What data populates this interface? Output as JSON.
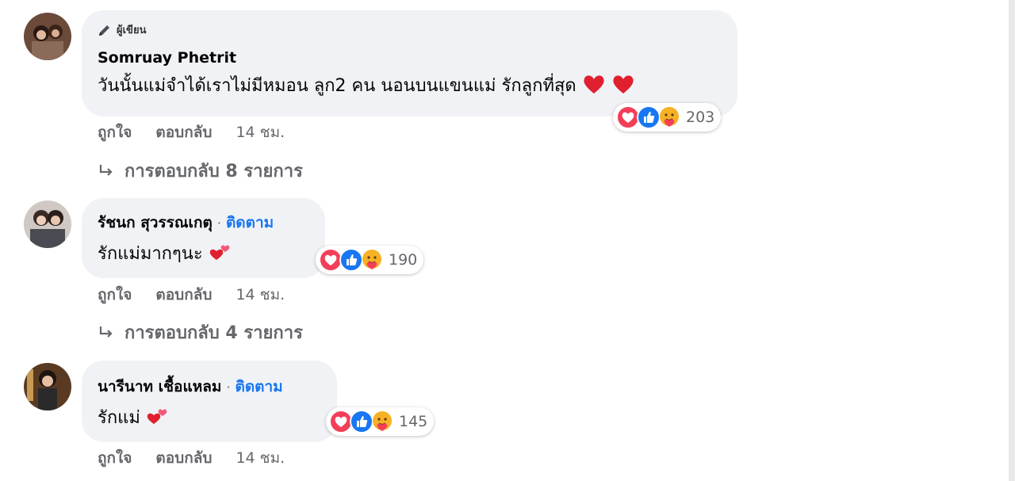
{
  "comments": [
    {
      "author_badge": "ผู้เขียน",
      "author": "Somruay Phetrit",
      "follow_label": "",
      "text": "วันนั้นแม่จำได้เราไม่มีหมอน ลูก2 คน นอนบนแขนแม่ รักลูกที่สุด",
      "trailing_emoji": "❤️❤️",
      "reaction_icons": [
        "love-icon",
        "like-icon",
        "care-icon"
      ],
      "reaction_count": "203",
      "actions": {
        "like": "ถูกใจ",
        "reply": "ตอบกลับ",
        "time": "14 ชม."
      },
      "replies_label": "การตอบกลับ 8 รายการ"
    },
    {
      "author_badge": "",
      "author": "รัชนก สุวรรณเกตุ",
      "separator": "·",
      "follow_label": "ติดตาม",
      "text": "รักแม่มากๆนะ",
      "trailing_emoji": "💕",
      "reaction_icons": [
        "love-icon",
        "like-icon",
        "care-icon"
      ],
      "reaction_count": "190",
      "actions": {
        "like": "ถูกใจ",
        "reply": "ตอบกลับ",
        "time": "14 ชม."
      },
      "replies_label": "การตอบกลับ 4 รายการ"
    },
    {
      "author_badge": "",
      "author": "นารีนาท เชื้อแหลม",
      "separator": "·",
      "follow_label": "ติดตาม",
      "text": "รักแม่ ",
      "trailing_emoji": "💕",
      "reaction_icons": [
        "love-icon",
        "like-icon",
        "care-icon"
      ],
      "reaction_count": "145",
      "actions": {
        "like": "ถูกใจ",
        "reply": "ตอบกลับ",
        "time": "14 ชม."
      },
      "replies_label": ""
    }
  ],
  "colors": {
    "link_blue": "#1877f2",
    "bubble_bg": "#f0f2f5",
    "muted_text": "#65676b",
    "love_red": "#f33e58",
    "like_blue": "#1877f2",
    "care_yellow": "#f7b125"
  }
}
